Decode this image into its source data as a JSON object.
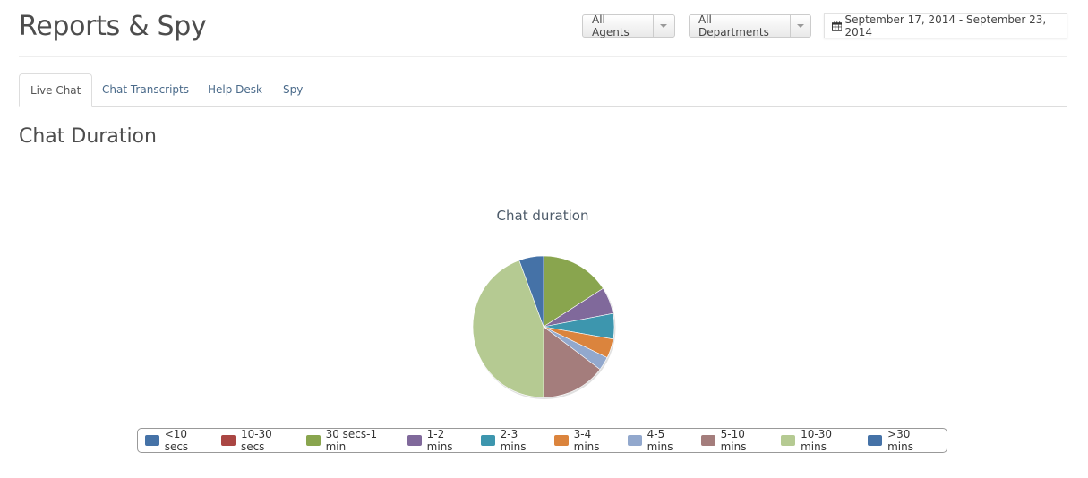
{
  "header": {
    "title": "Reports & Spy",
    "agents_filter": "All Agents",
    "departments_filter": "All Departments",
    "date_range": "September 17, 2014 - September 23, 2014"
  },
  "tabs": [
    {
      "label": "Live Chat",
      "active": true
    },
    {
      "label": "Chat Transcripts",
      "active": false
    },
    {
      "label": "Help Desk",
      "active": false
    },
    {
      "label": "Spy",
      "active": false
    }
  ],
  "section": {
    "title": "Chat Duration"
  },
  "chart_data": {
    "type": "pie",
    "title": "Chat duration",
    "legend_position": "bottom",
    "categories": [
      "<10 secs",
      "10-30 secs",
      "30 secs-1 min",
      "1-2 mins",
      "2-3 mins",
      "3-4 mins",
      "4-5 mins",
      "5-10 mins",
      "10-30 mins",
      ">30 mins"
    ],
    "values": [
      0,
      0.1,
      15.8,
      6.1,
      5.8,
      4.4,
      3.1,
      14.7,
      44.4,
      5.6
    ],
    "unit": "percent (estimated)",
    "colors": [
      "#4572A7",
      "#AA4643",
      "#89A54E",
      "#80699B",
      "#3D96AE",
      "#DB843D",
      "#92A8CD",
      "#A47D7C",
      "#B5CA92",
      "#4572A7"
    ]
  }
}
